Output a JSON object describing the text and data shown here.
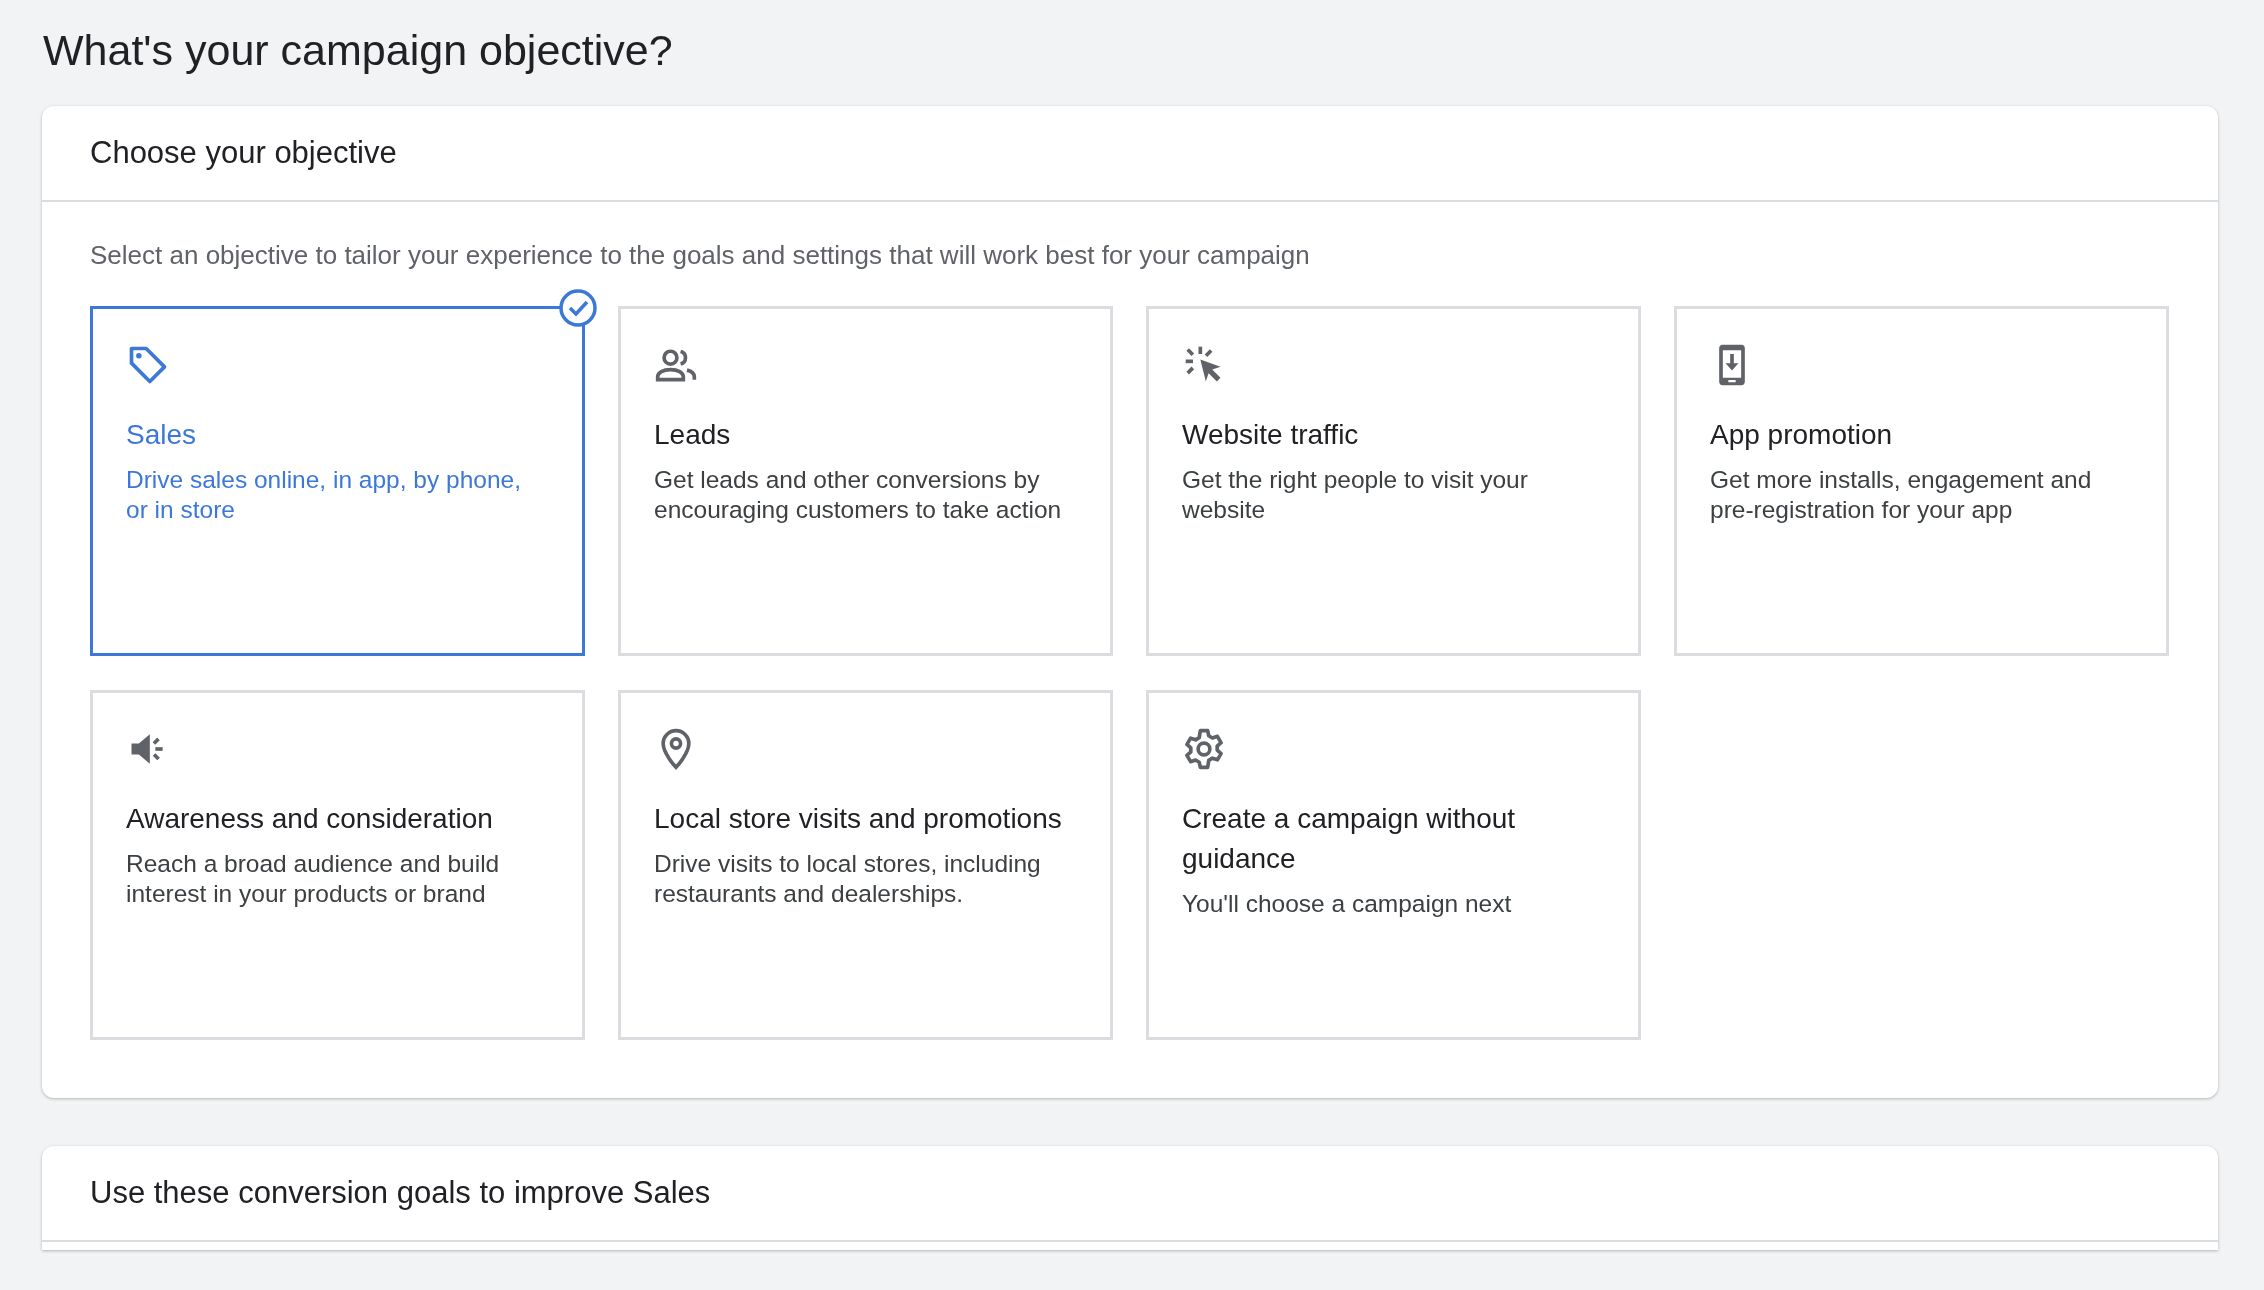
{
  "page_title": "What's your campaign objective?",
  "objective_card": {
    "title": "Choose your objective",
    "description": "Select an objective to tailor your experience to the goals and settings that will work best for your campaign",
    "objectives": [
      {
        "title": "Sales",
        "description": "Drive sales online, in app, by phone, or in store",
        "selected": true
      },
      {
        "title": "Leads",
        "description": "Get leads and other conversions by encouraging customers to take action",
        "selected": false
      },
      {
        "title": "Website traffic",
        "description": "Get the right people to visit your website",
        "selected": false
      },
      {
        "title": "App promotion",
        "description": "Get more installs, engagement and pre-registration for your app",
        "selected": false
      },
      {
        "title": "Awareness and consideration",
        "description": "Reach a broad audience and build interest in your products or brand",
        "selected": false
      },
      {
        "title": "Local store visits and promotions",
        "description": "Drive visits to local stores, including restaurants and dealerships.",
        "selected": false
      },
      {
        "title": "Create a campaign without guidance",
        "description": "You'll choose a campaign next",
        "selected": false
      }
    ]
  },
  "goals_card": {
    "title": "Use these conversion goals to improve Sales"
  }
}
